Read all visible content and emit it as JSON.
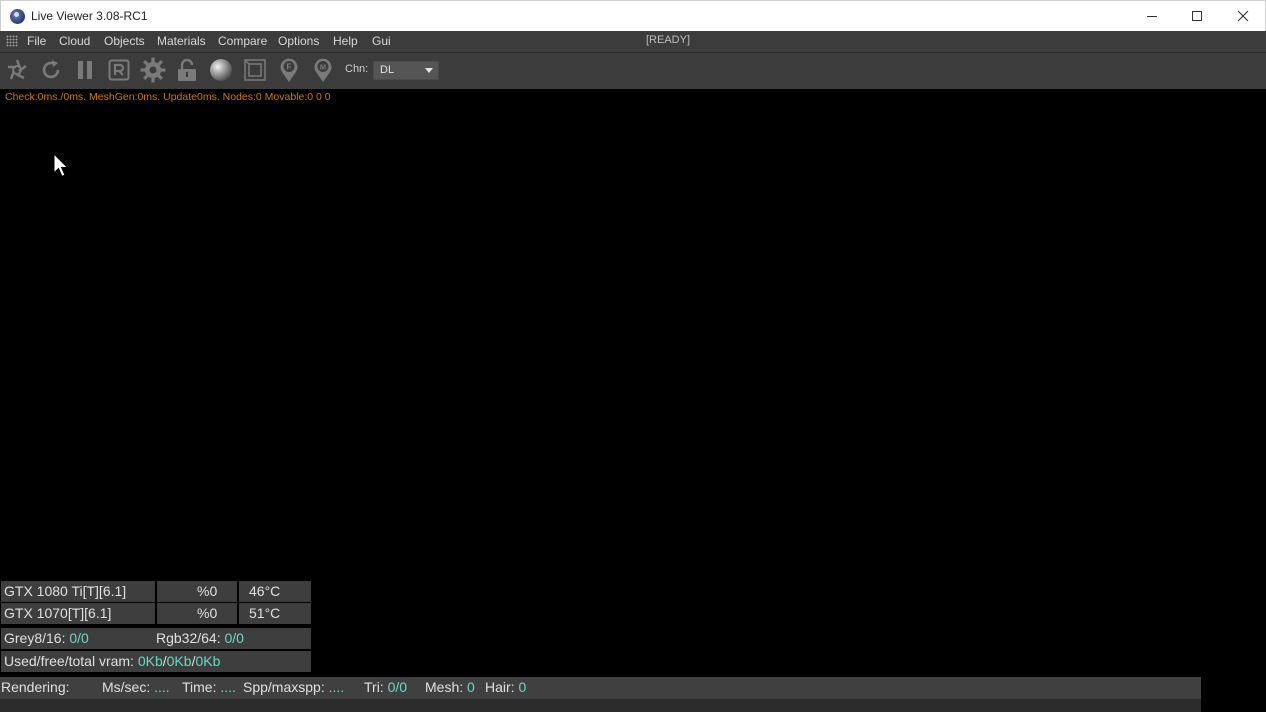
{
  "window": {
    "title": "Live Viewer 3.08-RC1",
    "icon": "cinema4d-app-icon"
  },
  "menu": {
    "items": [
      "File",
      "Cloud",
      "Objects",
      "Materials",
      "Compare",
      "Options",
      "Help",
      "Gui"
    ],
    "status": "[READY]"
  },
  "toolbar": {
    "icons": [
      "aperture-icon",
      "refresh-icon",
      "pause-icon",
      "render-region-icon",
      "gear-icon",
      "unlock-icon",
      "material-sphere-icon",
      "viewport-frame-icon",
      "focus-pin-icon",
      "material-pin-icon"
    ],
    "channel_label": "Chn:",
    "channel_value": "DL"
  },
  "viewport": {
    "stats": "Check:0ms./0ms. MeshGen:0ms. Update0ms. Nodes:0 Movable:0  0 0"
  },
  "gpus": [
    {
      "name": "GTX 1080 Ti[T][6.1]",
      "usage": "%0",
      "temp": "46°C"
    },
    {
      "name": "GTX 1070[T][6.1]",
      "usage": "%0",
      "temp": "51°C"
    }
  ],
  "textures": {
    "grey_label": "Grey8/16:",
    "grey_value": "0/0",
    "rgb_label": "Rgb32/64:",
    "rgb_value": "0/0"
  },
  "vram": {
    "label": "Used/free/total vram:",
    "used": "0Kb",
    "free": "0Kb",
    "total": "0Kb",
    "sep": "/"
  },
  "status": {
    "rendering_label": "Rendering:",
    "ms_label": "Ms/sec:",
    "ms_value": "....",
    "time_label": "Time:",
    "time_value": "....",
    "spp_label": "Spp/maxspp:",
    "spp_value": "....",
    "tri_label": "Tri:",
    "tri_value": "0/0",
    "mesh_label": "Mesh:",
    "mesh_value": "0",
    "hair_label": "Hair:",
    "hair_value": "0"
  },
  "colors": {
    "accent_value": "#6fd6c2",
    "stats_text": "#c77b16",
    "panel_bg": "#3c3c3c"
  }
}
